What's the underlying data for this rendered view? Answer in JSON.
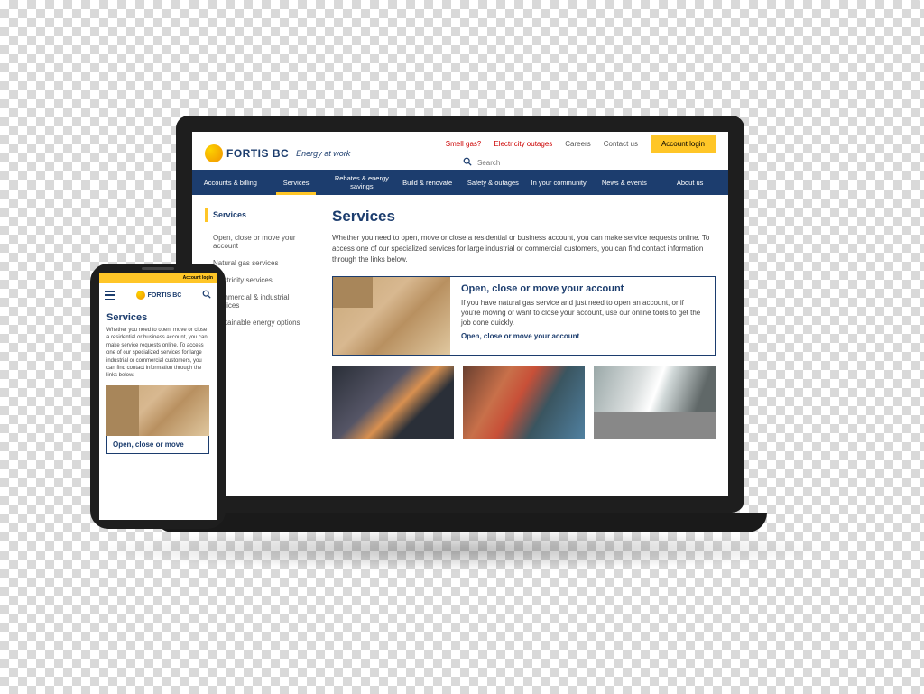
{
  "brand": {
    "name": "FORTIS BC",
    "tagline": "Energy at work"
  },
  "topbar": {
    "links": {
      "smell_gas": "Smell gas?",
      "outages": "Electricity outages",
      "careers": "Careers",
      "contact": "Contact us"
    },
    "account_login": "Account login",
    "search_placeholder": "Search"
  },
  "nav": {
    "items": [
      "Accounts & billing",
      "Services",
      "Rebates & energy savings",
      "Build & renovate",
      "Safety & outages",
      "In your community",
      "News & events",
      "About us"
    ],
    "active_index": 1
  },
  "sidebar": {
    "heading": "Services",
    "items": [
      "Open, close or move your account",
      "Natural gas services",
      "Electricity services",
      "Commercial & industrial services",
      "Sustainable energy options"
    ]
  },
  "page": {
    "title": "Services",
    "intro": "Whether you need to open, move or close a residential or business account, you can make service requests online. To access one of our specialized services for large industrial or commercial customers, you can find contact information through the links below."
  },
  "feature": {
    "title": "Open, close or move your account",
    "body": "If you have natural gas service and just need to open an account, or if you're moving or want to close your account, use our online tools to get the job done quickly.",
    "link": "Open, close or move your account"
  },
  "mobile": {
    "account_login": "Account login",
    "brand": "FORTIS BC",
    "title": "Services",
    "intro": "Whether you need to open, move or close a residential or business account, you can make service requests online. To access one of our specialized services for large industrial or commercial customers, you can find contact information through the links below.",
    "feature_title": "Open, close or move"
  }
}
